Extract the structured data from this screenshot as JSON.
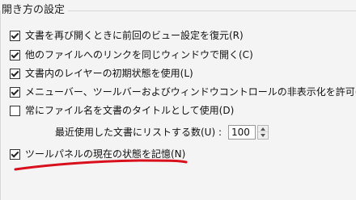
{
  "group": {
    "title": "開き方の設定"
  },
  "options": [
    {
      "label": "文書を再び開くときに前回のビュー設定を復元(R)",
      "checked": true
    },
    {
      "label": "他のファイルへのリンクを同じウィンドウで開く(C)",
      "checked": true
    },
    {
      "label": "文書内のレイヤーの初期状態を使用(L)",
      "checked": true
    },
    {
      "label": "メニューバー、ツールバーおよびウィンドウコントロールの非表示化を許可(W)",
      "checked": true
    },
    {
      "label": "常にファイル名を文書のタイトルとして使用(D)",
      "checked": false
    }
  ],
  "recent_list": {
    "label": "最近使用した文書にリストする数(U) :",
    "value": "100"
  },
  "remember_tools": {
    "label": "ツールパネルの現在の状態を記憶(N)",
    "checked": true
  },
  "annotation": {
    "stroke_color": "#d8101c"
  }
}
